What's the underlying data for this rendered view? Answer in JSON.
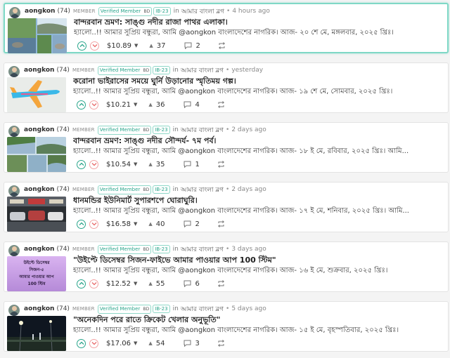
{
  "colors": {
    "accent": "#2aa68c",
    "downvote": "#e86b6b",
    "card_border_active": "#7fd8c6"
  },
  "posts": [
    {
      "author": "aongkon",
      "reputation": "(74)",
      "role": "MEMBER",
      "verified": "Verified Member",
      "flag": "BD",
      "badge": "IB-23",
      "in_word": "in",
      "community": "আমার বাংলা ব্লগ",
      "dot": "•",
      "time": "4 hours ago",
      "title": "বান্দরবান ভ্রমণ: সাঙ্গু নদীর রাজা পাথর এলাকা।",
      "excerpt": "হ্যালো..!! আমার সুপ্রিয় বন্ধুরা, আমি @aongkon বাংলাদেশের নাগরিক। আজ- ২০ শে মে, মঙ্গলবার, ২০২৫ খ্রিঃ।",
      "payout": "$10.89",
      "votes": "37",
      "comments": "2",
      "thumb": "river-rocks"
    },
    {
      "author": "aongkon",
      "reputation": "(74)",
      "role": "MEMBER",
      "verified": "Verified Member",
      "flag": "BD",
      "badge": "IB-23",
      "in_word": "in",
      "community": "আমার বাংলা ব্লগ",
      "dot": "•",
      "time": "yesterday",
      "title": "করোনা ভাইরাসের সময়ে ঘুর্নি উড়ানোর স্মৃতিময় গল্প।",
      "excerpt": "হ্যালো..!! আমার সুপ্রিয় বন্ধুরা, আমি @aongkon বাংলাদেশের নাগরিক। আজ- ১৯ শে মে, সোমবার, ২০২৫ খ্রিঃ।",
      "payout": "$10.21",
      "votes": "36",
      "comments": "4",
      "thumb": "paper-plane"
    },
    {
      "author": "aongkon",
      "reputation": "(74)",
      "role": "MEMBER",
      "verified": "Verified Member",
      "flag": "BD",
      "badge": "IB-23",
      "in_word": "in",
      "community": "আমার বাংলা ব্লগ",
      "dot": "•",
      "time": "2 days ago",
      "title": "বান্দরবান ভ্রমণ: সাঙ্গু নদীর সৌন্দর্য- ৭ম পর্ব।",
      "excerpt": "হ্যালো..!! আমার সুপ্রিয় বন্ধুরা, আমি @aongkon বাংলাদেশের নাগরিক। আজ- ১৮ ই মে, রবিবার, ২০২৫ খ্রিঃ। আমি...",
      "payout": "$10.54",
      "votes": "35",
      "comments": "1",
      "thumb": "river-forest"
    },
    {
      "author": "aongkon",
      "reputation": "(74)",
      "role": "MEMBER",
      "verified": "Verified Member",
      "flag": "BD",
      "badge": "IB-23",
      "in_word": "in",
      "community": "আমার বাংলা ব্লগ",
      "dot": "•",
      "time": "2 days ago",
      "title": "ধানমন্ডির ইউনিমার্ট সুপারশপে ঘোরাঘুরি।",
      "excerpt": "হ্যালো..!! আমার সুপ্রিয় বন্ধুরা, আমি @aongkon বাংলাদেশের নাগরিক। আজ- ১৭ ই মে, শনিবার, ২০২৫ খ্রিঃ। আমি...",
      "payout": "$16.58",
      "votes": "40",
      "comments": "2",
      "thumb": "supershop"
    },
    {
      "author": "aongkon",
      "reputation": "(74)",
      "role": "MEMBER",
      "verified": "Verified Member",
      "flag": "BD",
      "badge": "IB-23",
      "in_word": "in",
      "community": "আমার বাংলা ব্লগ",
      "dot": "•",
      "time": "3 days ago",
      "title": "\"উইপ্টে ডিসেম্বর সিজন-ফাইভে আমার পাওয়ার আপ 100 স্টিম\"",
      "excerpt": "হ্যালো..!! আমার সুপ্রিয় বন্ধুরা, আমি @aongkon বাংলাদেশের নাগরিক। আজ- ১৬ ই মে, শুক্রবার, ২০২৫ খ্রিঃ।",
      "payout": "$12.52",
      "votes": "55",
      "comments": "6",
      "thumb": "poster",
      "thumb_text": [
        "উইপ্টে ডিসেম্বর",
        "সিজন-৫",
        "আমার পাওয়ার আপ",
        "100 স্টিম"
      ]
    },
    {
      "author": "aongkon",
      "reputation": "(74)",
      "role": "MEMBER",
      "verified": "Verified Member",
      "flag": "BD",
      "badge": "IB-23",
      "in_word": "in",
      "community": "আমার বাংলা ব্লগ",
      "dot": "•",
      "time": "5 days ago",
      "title": "\"অনেকদিন পরে রাতে ক্রিকেট খেলার অনুভূতি\"",
      "excerpt": "হ্যালো..!! আমার সুপ্রিয় বন্ধুরা, আমি @aongkon বাংলাদেশের নাগরিক। আজ- ১৫ ই মে, বৃহস্পতিবার, ২০২৫ খ্রিঃ।",
      "payout": "$17.06",
      "votes": "54",
      "comments": "3",
      "thumb": "night-cricket"
    }
  ]
}
